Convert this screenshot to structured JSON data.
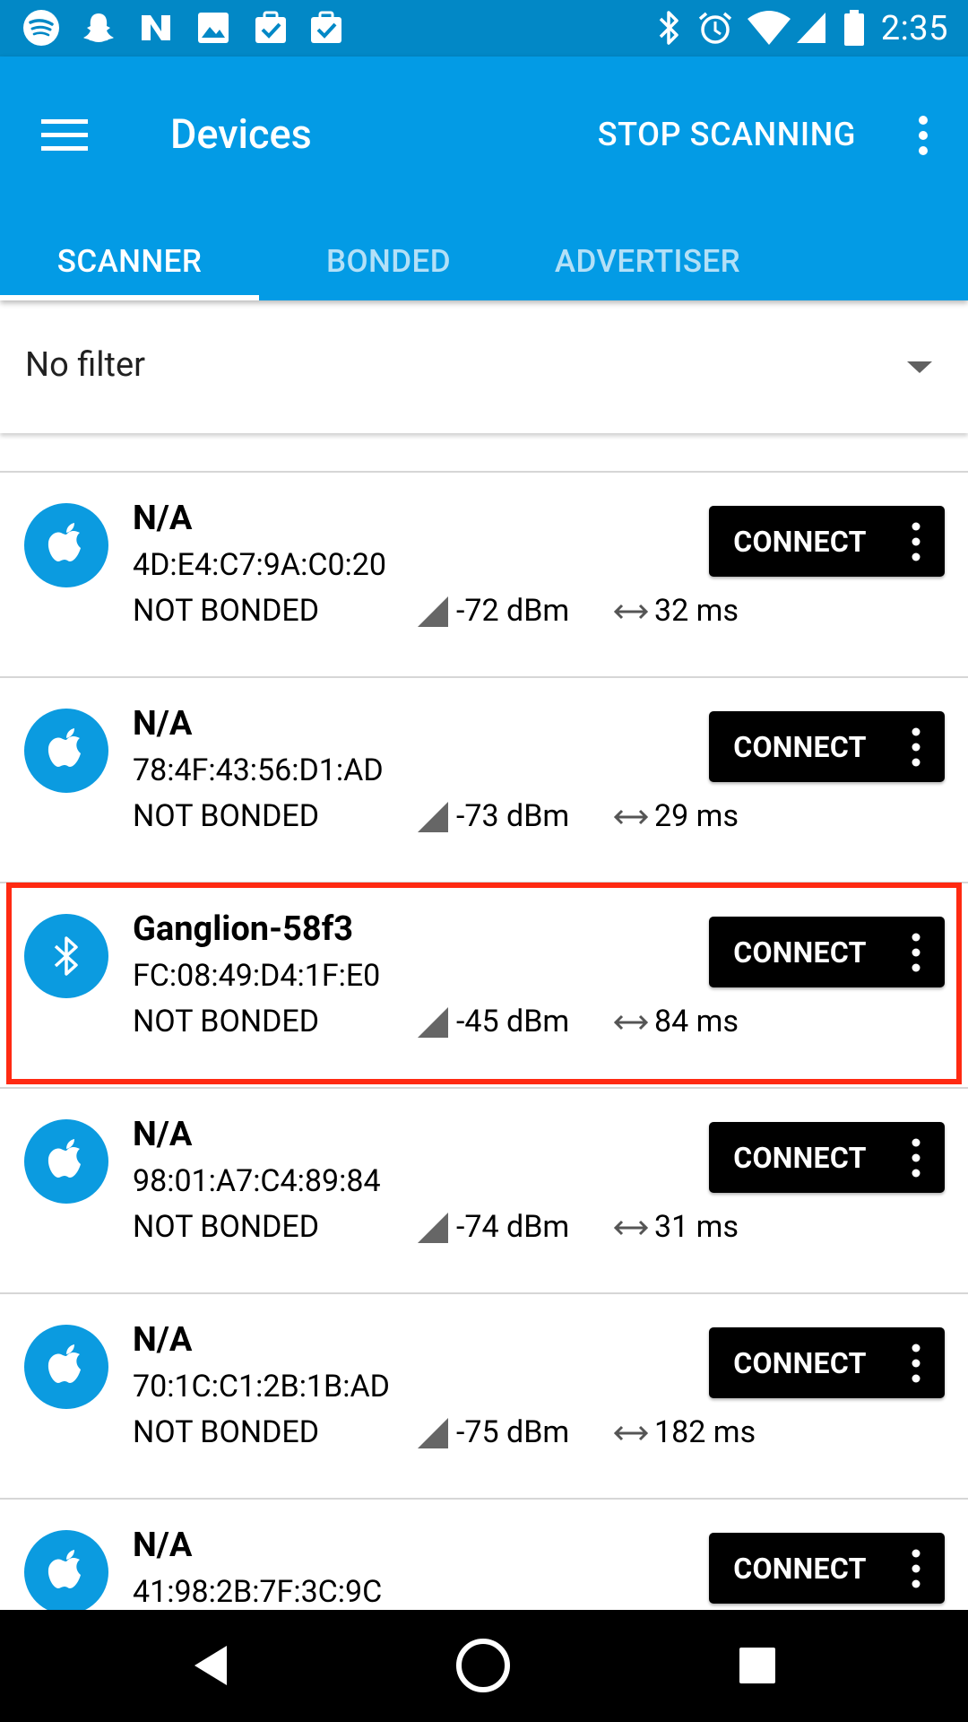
{
  "status_bar": {
    "time": "2:35",
    "left_icons": [
      "spotify-icon",
      "snapchat-icon",
      "nova-launcher-icon",
      "gallery-icon",
      "task-icon",
      "task-icon-2"
    ],
    "right_icons": [
      "bluetooth-icon",
      "alarm-icon",
      "wifi-icon",
      "cell-signal-icon",
      "battery-icon"
    ]
  },
  "app_bar": {
    "title": "Devices",
    "action": "STOP SCANNING",
    "menu_icon": "hamburger-menu-icon",
    "overflow_icon": "more-vert-icon",
    "color": "#039be5"
  },
  "tabs": [
    {
      "label": "SCANNER",
      "active": true
    },
    {
      "label": "BONDED",
      "active": false
    },
    {
      "label": "ADVERTISER",
      "active": false
    }
  ],
  "filter": {
    "value": "No filter",
    "icon": "dropdown-arrow-icon"
  },
  "devices": [
    {
      "name": "N/A",
      "address": "4D:E4:C7:9A:C0:20",
      "bond": "NOT BONDED",
      "rssi": "-72 dBm",
      "interval": "32 ms",
      "icon": "apple-icon",
      "button": "CONNECT"
    },
    {
      "name": "N/A",
      "address": "78:4F:43:56:D1:AD",
      "bond": "NOT BONDED",
      "rssi": "-73 dBm",
      "interval": "29 ms",
      "icon": "apple-icon",
      "button": "CONNECT"
    },
    {
      "name": "Ganglion-58f3",
      "address": "FC:08:49:D4:1F:E0",
      "bond": "NOT BONDED",
      "rssi": "-45 dBm",
      "interval": "84 ms",
      "icon": "bluetooth-icon",
      "button": "CONNECT",
      "highlighted": true
    },
    {
      "name": "N/A",
      "address": "98:01:A7:C4:89:84",
      "bond": "NOT BONDED",
      "rssi": "-74 dBm",
      "interval": "31 ms",
      "icon": "apple-icon",
      "button": "CONNECT"
    },
    {
      "name": "N/A",
      "address": "70:1C:C1:2B:1B:AD",
      "bond": "NOT BONDED",
      "rssi": "-75 dBm",
      "interval": "182 ms",
      "icon": "apple-icon",
      "button": "CONNECT"
    },
    {
      "name": "N/A",
      "address": "41:98:2B:7F:3C:9C",
      "bond": "",
      "rssi": "",
      "interval": "",
      "icon": "apple-icon",
      "button": "CONNECT"
    }
  ],
  "highlight_color": "#ff2a12",
  "nav_bar": {
    "back": "back-icon",
    "home": "home-icon",
    "recents": "recents-icon"
  }
}
